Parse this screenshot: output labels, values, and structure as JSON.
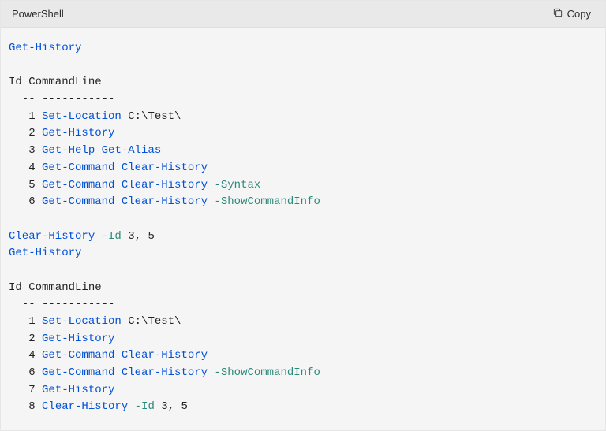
{
  "header": {
    "language": "PowerShell",
    "copy_label": "Copy"
  },
  "code": {
    "line1_cmd": "Get-History",
    "hdr1": "Id CommandLine",
    "dashes": "  -- -----------",
    "r1_id": "   1 ",
    "r1_cmd": "Set-Location",
    "r1_rest": " C:\\Test\\",
    "r2_id": "   2 ",
    "r2_cmd": "Get-History",
    "r3_id": "   3 ",
    "r3_cmd": "Get-Help",
    "r3_sp": " ",
    "r3_cmd2": "Get-Alias",
    "r4_id": "   4 ",
    "r4_cmd": "Get-Command",
    "r4_sp": " ",
    "r4_cmd2": "Clear-History",
    "r5_id": "   5 ",
    "r5_cmd": "Get-Command",
    "r5_sp": " ",
    "r5_cmd2": "Clear-History",
    "r5_sp2": " ",
    "r5_param": "-Syntax",
    "r6_id": "   6 ",
    "r6_cmd": "Get-Command",
    "r6_sp": " ",
    "r6_cmd2": "Clear-History",
    "r6_sp2": " ",
    "r6_param": "-ShowCommandInfo",
    "clear_cmd": "Clear-History",
    "clear_sp": " ",
    "clear_param": "-Id",
    "clear_rest": " 3, 5",
    "line2_cmd": "Get-History",
    "hdr2": "Id CommandLine",
    "s1_id": "   1 ",
    "s1_cmd": "Set-Location",
    "s1_rest": " C:\\Test\\",
    "s2_id": "   2 ",
    "s2_cmd": "Get-History",
    "s4_id": "   4 ",
    "s4_cmd": "Get-Command",
    "s4_sp": " ",
    "s4_cmd2": "Clear-History",
    "s6_id": "   6 ",
    "s6_cmd": "Get-Command",
    "s6_sp": " ",
    "s6_cmd2": "Clear-History",
    "s6_sp2": " ",
    "s6_param": "-ShowCommandInfo",
    "s7_id": "   7 ",
    "s7_cmd": "Get-History",
    "s8_id": "   8 ",
    "s8_cmd": "Clear-History",
    "s8_sp": " ",
    "s8_param": "-Id",
    "s8_rest": " 3, 5"
  }
}
